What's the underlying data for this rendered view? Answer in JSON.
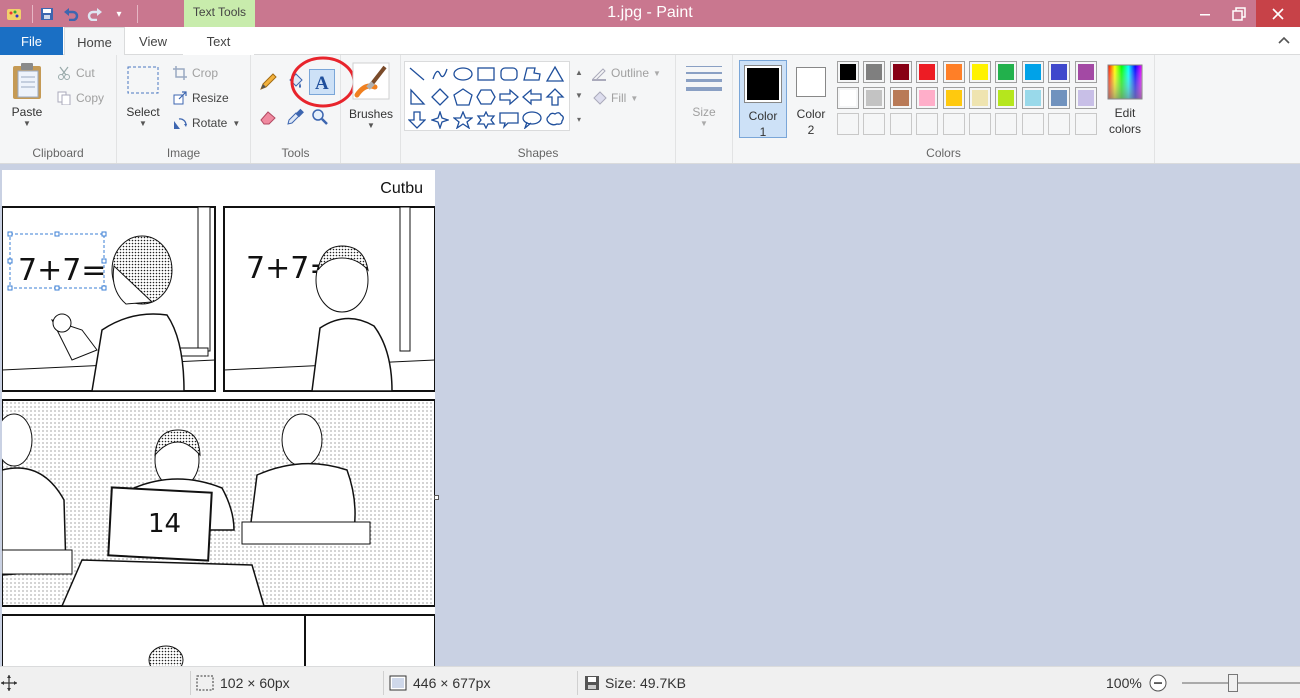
{
  "window": {
    "title": "1.jpg - Paint",
    "contextual_tab_group": "Text Tools"
  },
  "tabs": {
    "file": "File",
    "home": "Home",
    "view": "View",
    "text": "Text"
  },
  "clipboard": {
    "paste": "Paste",
    "cut": "Cut",
    "copy": "Copy",
    "group": "Clipboard"
  },
  "image": {
    "select": "Select",
    "crop": "Crop",
    "resize": "Resize",
    "rotate": "Rotate",
    "group": "Image"
  },
  "tools": {
    "group": "Tools",
    "brushes": "Brushes"
  },
  "shapes": {
    "outline": "Outline",
    "fill": "Fill",
    "group": "Shapes"
  },
  "size": {
    "label": "Size"
  },
  "colors": {
    "color1_label": "Color 1",
    "color1_line1": "Color",
    "color1_line2": "1",
    "color2_line1": "Color",
    "color2_line2": "2",
    "edit_line1": "Edit",
    "edit_line2": "colors",
    "group": "Colors",
    "color1": "#000000",
    "color2": "#ffffff",
    "palette_row1": [
      "#000000",
      "#7f7f7f",
      "#880015",
      "#ed1c24",
      "#ff7f27",
      "#fff200",
      "#22b14c",
      "#00a2e8",
      "#3f48cc",
      "#a349a4"
    ],
    "palette_row2": [
      "#ffffff",
      "#c3c3c3",
      "#b97a57",
      "#ffaec9",
      "#ffc90e",
      "#efe4b0",
      "#b5e61d",
      "#99d9ea",
      "#7092be",
      "#c8bfe7"
    ],
    "highlight": "#e8242c"
  },
  "canvas": {
    "corner_label": "Cutbu",
    "panel1_text": "7+7=",
    "panel2_text": "7+7=",
    "card_text": "14"
  },
  "status": {
    "selection_size": "102 × 60px",
    "image_size": "446 × 677px",
    "file_size": "Size: 49.7KB",
    "zoom": "100%"
  }
}
